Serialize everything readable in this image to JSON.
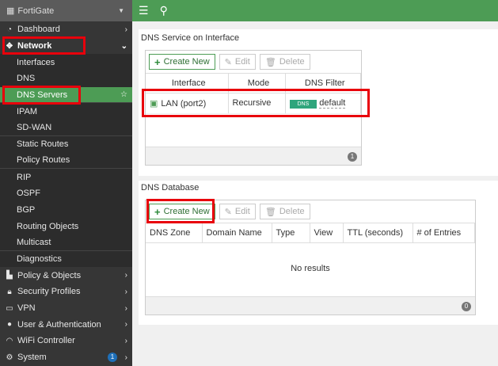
{
  "sidebar": {
    "title": "FortiGate",
    "items": [
      {
        "label": "Dashboard",
        "icon": "dashboard-icon"
      },
      {
        "label": "Network",
        "icon": "network-icon"
      },
      {
        "label": "Interfaces"
      },
      {
        "label": "DNS"
      },
      {
        "label": "DNS Servers"
      },
      {
        "label": "IPAM"
      },
      {
        "label": "SD-WAN"
      },
      {
        "label": "Static Routes"
      },
      {
        "label": "Policy Routes"
      },
      {
        "label": "RIP"
      },
      {
        "label": "OSPF"
      },
      {
        "label": "BGP"
      },
      {
        "label": "Routing Objects"
      },
      {
        "label": "Multicast"
      },
      {
        "label": "Diagnostics"
      },
      {
        "label": "Policy & Objects"
      },
      {
        "label": "Security Profiles"
      },
      {
        "label": "VPN"
      },
      {
        "label": "User & Authentication"
      },
      {
        "label": "WiFi Controller"
      },
      {
        "label": "System",
        "badge": "1"
      }
    ]
  },
  "dns_service": {
    "title": "DNS Service on Interface",
    "create": "Create New",
    "edit": "Edit",
    "delete": "Delete",
    "columns": [
      "Interface",
      "Mode",
      "DNS Filter"
    ],
    "rows": [
      {
        "interface": "LAN (port2)",
        "mode": "Recursive",
        "badge": "DNS",
        "filter": "default"
      }
    ],
    "count": "1"
  },
  "dns_db": {
    "title": "DNS Database",
    "create": "Create New",
    "edit": "Edit",
    "delete": "Delete",
    "columns": [
      "DNS Zone",
      "Domain Name",
      "Type",
      "View",
      "TTL (seconds)",
      "# of Entries"
    ],
    "empty": "No results",
    "count": "0"
  }
}
